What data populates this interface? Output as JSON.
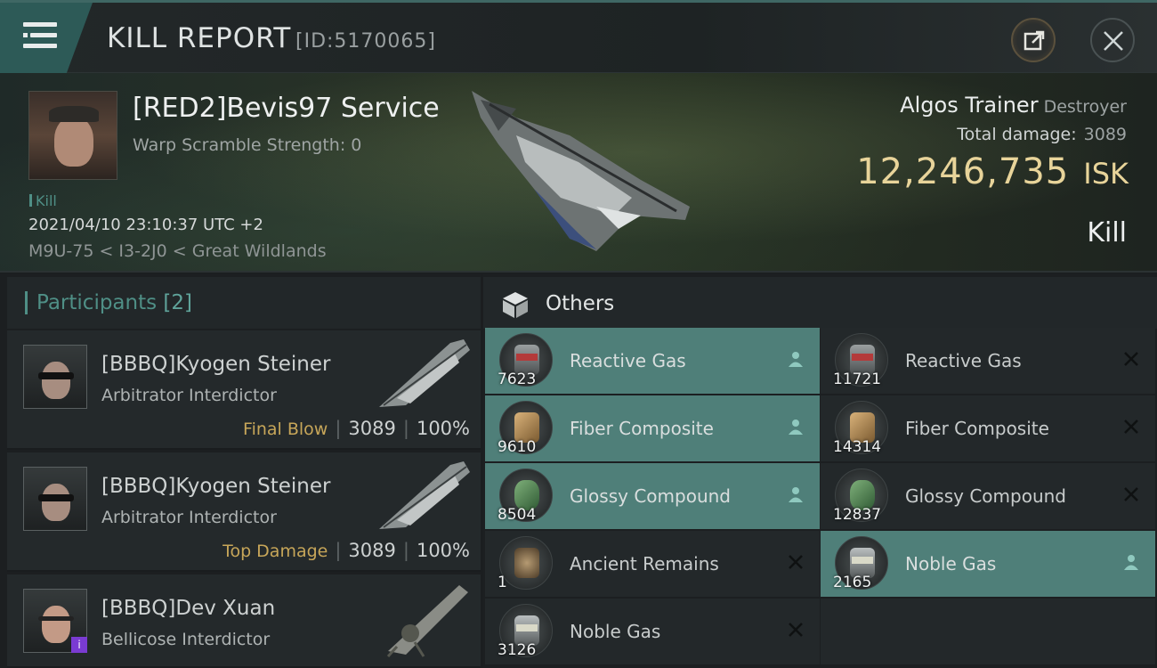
{
  "window": {
    "title": "KILL REPORT",
    "report_id": "[ID:5170065]"
  },
  "victim": {
    "name": "[RED2]Bevis97 Service",
    "warp_scramble": "Warp Scramble Strength: 0",
    "tag": "Kill",
    "timestamp": "2021/04/10 23:10:37 UTC +2",
    "location": "M9U-75 < I3-2J0 < Great Wildlands",
    "ship_name": "Algos Trainer",
    "ship_class": "Destroyer",
    "total_damage_label": "Total damage:",
    "total_damage": "3089",
    "isk_value": "12,246,735",
    "isk_unit": "ISK",
    "result": "Kill"
  },
  "participants": {
    "title": "Participants",
    "count": "[2]",
    "rows": [
      {
        "name": "[BBBQ]Kyogen Steiner",
        "ship": "Arbitrator Interdictor",
        "role": "Final Blow",
        "damage": "3089",
        "percent": "100%"
      },
      {
        "name": "[BBBQ]Kyogen Steiner",
        "ship": "Arbitrator Interdictor",
        "role": "Top Damage",
        "damage": "3089",
        "percent": "100%"
      },
      {
        "name": "[BBBQ]Dev Xuan",
        "ship": "Bellicose Interdictor",
        "role": "",
        "damage": "",
        "percent": ""
      }
    ]
  },
  "others": {
    "title": "Others",
    "items": [
      {
        "name": "Reactive Gas",
        "qty": "7623",
        "status": "dropped",
        "icon": "gas-canister-icon"
      },
      {
        "name": "Reactive Gas",
        "qty": "11721",
        "status": "destroyed",
        "icon": "gas-canister-icon"
      },
      {
        "name": "Fiber Composite",
        "qty": "9610",
        "status": "dropped",
        "icon": "fiber-composite-icon"
      },
      {
        "name": "Fiber Composite",
        "qty": "14314",
        "status": "destroyed",
        "icon": "fiber-composite-icon"
      },
      {
        "name": "Glossy Compound",
        "qty": "8504",
        "status": "dropped",
        "icon": "glossy-compound-icon"
      },
      {
        "name": "Glossy Compound",
        "qty": "12837",
        "status": "destroyed",
        "icon": "glossy-compound-icon"
      },
      {
        "name": "Ancient Remains",
        "qty": "1",
        "status": "destroyed",
        "icon": "ancient-remains-icon"
      },
      {
        "name": "Noble Gas",
        "qty": "2165",
        "status": "dropped",
        "icon": "gas-canister-icon"
      },
      {
        "name": "Noble Gas",
        "qty": "3126",
        "status": "destroyed",
        "icon": "gas-canister-icon"
      }
    ]
  },
  "colors": {
    "accent": "#4f8f86",
    "dropped_row": "#4f7f79",
    "isk": "#e8d49a",
    "role_label": "#c7a659"
  }
}
